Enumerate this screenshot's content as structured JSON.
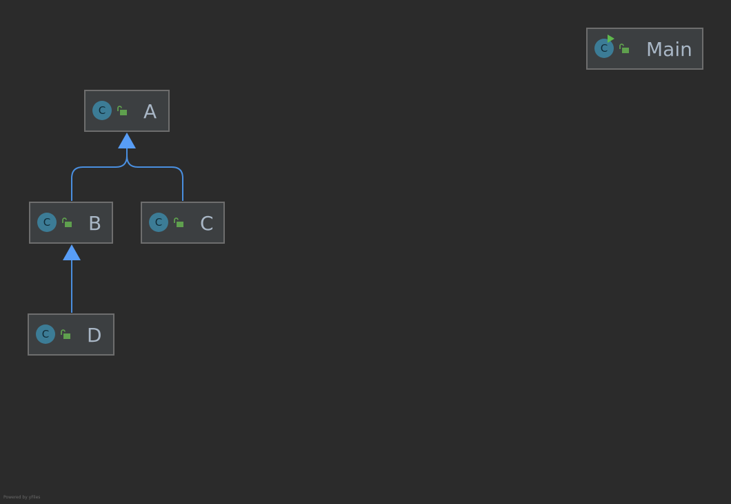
{
  "diagram": {
    "nodes": [
      {
        "id": "A",
        "label": "A",
        "icon": "class-icon",
        "icon_letter": "C",
        "visibility_icon": "public-unlock-icon"
      },
      {
        "id": "B",
        "label": "B",
        "icon": "class-icon",
        "icon_letter": "C",
        "visibility_icon": "public-unlock-icon"
      },
      {
        "id": "C",
        "label": "C",
        "icon": "class-icon",
        "icon_letter": "C",
        "visibility_icon": "public-unlock-icon"
      },
      {
        "id": "D",
        "label": "D",
        "icon": "class-icon",
        "icon_letter": "C",
        "visibility_icon": "public-unlock-icon"
      },
      {
        "id": "Main",
        "label": "Main",
        "icon": "runnable-class-icon",
        "icon_letter": "C",
        "visibility_icon": "public-unlock-icon"
      }
    ],
    "edges": [
      {
        "from": "B",
        "to": "A",
        "type": "extends"
      },
      {
        "from": "C",
        "to": "A",
        "type": "extends"
      },
      {
        "from": "D",
        "to": "B",
        "type": "extends"
      }
    ]
  },
  "colors": {
    "background": "#2b2b2b",
    "node_fill": "#3c3f41",
    "node_border": "#6e6e6e",
    "class_icon": "#3c7c96",
    "lock": "#5fa04e",
    "run_badge": "#5fb84d",
    "edge": "#4a8fe0",
    "arrowhead": "#589df6",
    "label_text": "#a9b7c6"
  },
  "footer": {
    "text": "Powered by yFiles"
  }
}
